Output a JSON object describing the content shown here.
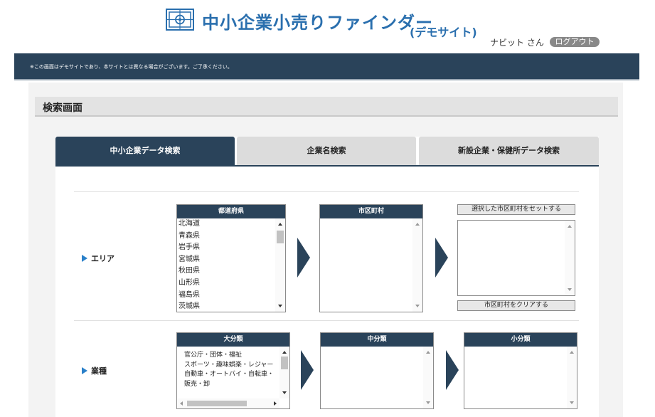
{
  "header": {
    "logo_icon": "grid-target-icon",
    "title": "中小企業小売りファインダー",
    "subtitle": "(デモサイト)",
    "user": "ナビット さん",
    "logout": "ログアウト"
  },
  "notice": "※この画面はデモサイトであり、本サイトとは異なる場合がございます。ご了承ください。",
  "page": {
    "title": "検索画面"
  },
  "tabs": [
    {
      "label": "中小企業データ検索",
      "active": true
    },
    {
      "label": "企業名検索",
      "active": false
    },
    {
      "label": "新設企業・保健所データ検索",
      "active": false
    }
  ],
  "area": {
    "label": "エリア",
    "prefecture": {
      "header": "都道府県",
      "items": [
        "北海道",
        "青森県",
        "岩手県",
        "宮城県",
        "秋田県",
        "山形県",
        "福島県",
        "茨城県"
      ]
    },
    "city": {
      "header": "市区町村",
      "items": []
    },
    "set_button": "選択した市区町村をセットする",
    "clear_button": "市区町村をクリアする"
  },
  "industry": {
    "label": "業種",
    "major": {
      "header": "大分類",
      "items": [
        "官公庁・団体・福祉",
        "スポーツ・趣味娯楽・レジャー",
        "自動車・オートバイ・自転車・",
        "販売・卸"
      ]
    },
    "middle": {
      "header": "中分類",
      "items": []
    },
    "minor": {
      "header": "小分類",
      "items": []
    }
  },
  "colors": {
    "navy": "#2a435a",
    "brand_blue": "#2a6fae",
    "accent_blue": "#2a80c9"
  }
}
